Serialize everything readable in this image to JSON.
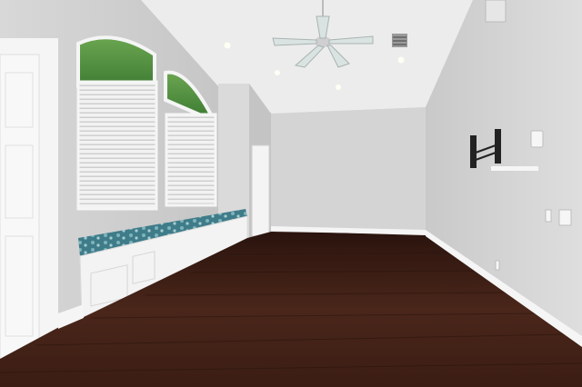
{
  "scene": {
    "subject": "empty-room-interior",
    "colors": {
      "wall": "#cfcfcf",
      "wall_light": "#e1e1e1",
      "ceiling": "#ececec",
      "floor": "#3b1d14",
      "floor_mid": "#4a261a",
      "trim": "#f7f7f7",
      "cushion": "#3f7c8a",
      "foliage": "#4c8a3a"
    },
    "icons": [
      "ceiling-fan-icon",
      "tv-wall-mount-icon",
      "thermostat-icon",
      "light-switch-icon",
      "outlet-icon",
      "vent-icon"
    ]
  }
}
